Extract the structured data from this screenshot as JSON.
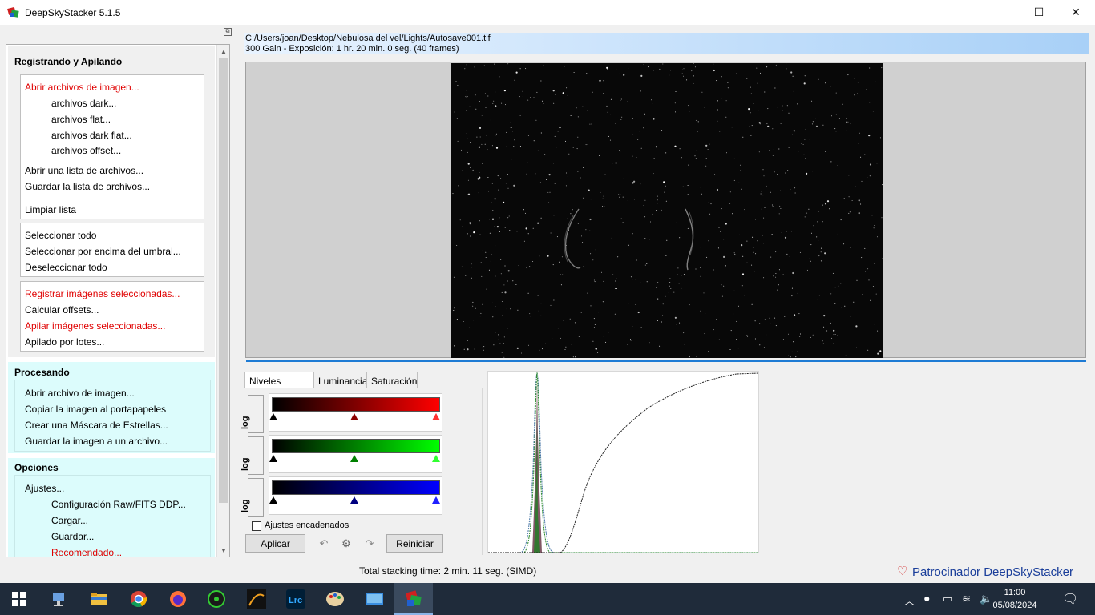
{
  "window": {
    "title": "DeepSkyStacker 5.1.5",
    "minimize": "—",
    "maximize": "☐",
    "close": "✕"
  },
  "sidebar": {
    "registering": {
      "title": "Registrando y Apilando",
      "group1": [
        {
          "label": "Abrir archivos de imagen...",
          "highlight": true
        },
        {
          "label": "archivos dark...",
          "highlight": false
        },
        {
          "label": "archivos flat...",
          "highlight": false
        },
        {
          "label": "archivos dark flat...",
          "highlight": false
        },
        {
          "label": "archivos offset...",
          "highlight": false
        },
        {
          "label": "Abrir una lista de archivos...",
          "highlight": false
        },
        {
          "label": "Guardar la lista de archivos...",
          "highlight": false
        },
        {
          "label": "Limpiar lista",
          "highlight": false
        }
      ],
      "group2": [
        {
          "label": "Seleccionar todo"
        },
        {
          "label": "Seleccionar por encima del umbral..."
        },
        {
          "label": "Deseleccionar todo"
        }
      ],
      "group3": [
        {
          "label": "Registrar imágenes seleccionadas...",
          "highlight": true
        },
        {
          "label": "Calcular offsets...",
          "highlight": false
        },
        {
          "label": "Apilar imágenes seleccionadas...",
          "highlight": true
        },
        {
          "label": "Apilado por lotes...",
          "highlight": false
        }
      ]
    },
    "processing": {
      "title": "Procesando",
      "items": [
        {
          "label": "Abrir archivo de imagen..."
        },
        {
          "label": "Copiar la imagen al portapapeles"
        },
        {
          "label": "Crear una Máscara de Estrellas..."
        },
        {
          "label": "Guardar la imagen a un archivo..."
        }
      ]
    },
    "options": {
      "title": "Opciones",
      "items": [
        {
          "label": "Ajustes...",
          "highlight": false
        },
        {
          "label": "Configuración Raw/FITS DDP...",
          "highlight": false
        },
        {
          "label": "Cargar...",
          "highlight": false
        },
        {
          "label": "Guardar...",
          "highlight": false
        },
        {
          "label": "Recomendado...",
          "highlight": true
        }
      ]
    }
  },
  "info": {
    "path": "C:/Users/joan/Desktop/Nebulosa del vel/Lights/Autosave001.tif",
    "details": "300 Gain - Exposición: 1 hr. 20 min. 0 seg. (40 frames)"
  },
  "levels": {
    "tabs": [
      "Niveles RGB/K",
      "Luminancia",
      "Saturación"
    ],
    "active_tab": "Niveles RGB/K",
    "log_label": "log",
    "channels": [
      {
        "name": "red",
        "color": "#ff0000",
        "mid_color": "#8b0000"
      },
      {
        "name": "green",
        "color": "#00ff00",
        "mid_color": "#008000"
      },
      {
        "name": "blue",
        "color": "#0000ff",
        "mid_color": "#000080"
      }
    ],
    "linked_label": "Ajustes encadenados",
    "linked_checked": false,
    "apply_label": "Aplicar",
    "reset_label": "Reiniciar"
  },
  "status": {
    "stacking_time": "Total stacking time: 2 min. 11 seg.  (SIMD)",
    "sponsor": "Patrocinador DeepSkyStacker"
  },
  "taskbar": {
    "time": "11:00",
    "date": "05/08/2024"
  },
  "colors": {
    "accent": "#1e7bd4",
    "highlight_text": "#e00000",
    "cyan_panel": "#dcfcfc",
    "taskbar": "#1f2b3a"
  }
}
